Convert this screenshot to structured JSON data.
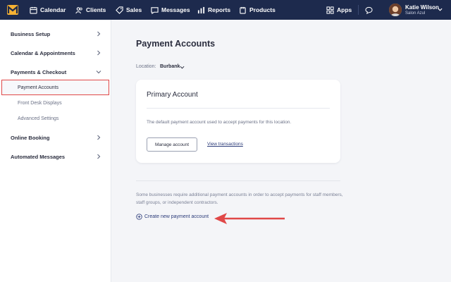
{
  "nav": {
    "items": [
      {
        "label": "Calendar",
        "icon": "calendar-icon"
      },
      {
        "label": "Clients",
        "icon": "clients-icon"
      },
      {
        "label": "Sales",
        "icon": "sales-tag-icon"
      },
      {
        "label": "Messages",
        "icon": "messages-icon"
      },
      {
        "label": "Reports",
        "icon": "reports-chart-icon"
      },
      {
        "label": "Products",
        "icon": "products-icon"
      }
    ],
    "apps_label": "Apps",
    "user": {
      "name": "Katie Wilson",
      "business": "Salon Azul"
    }
  },
  "sidebar": {
    "items": [
      {
        "label": "Business Setup"
      },
      {
        "label": "Calendar & Appointments"
      },
      {
        "label": "Payments & Checkout"
      },
      {
        "label": "Online Booking"
      },
      {
        "label": "Automated Messages"
      }
    ],
    "subitems": [
      {
        "label": "Payment Accounts"
      },
      {
        "label": "Front Desk Displays"
      },
      {
        "label": "Advanced Settings"
      }
    ]
  },
  "main": {
    "title": "Payment Accounts",
    "location_label": "Location:",
    "location_value": "Burbank",
    "card": {
      "title": "Primary Account",
      "description": "The default payment account used to accept payments for this location.",
      "manage_label": "Manage account",
      "view_label": "View transactions"
    },
    "info_text": "Some businesses require additional payment accounts in order to accept payments for staff members, staff groups, or independent contractors.",
    "create_label": "Create new payment account"
  },
  "colors": {
    "nav_bg": "#1d2a4d",
    "highlight": "#e04848",
    "link": "#2a3a78"
  }
}
